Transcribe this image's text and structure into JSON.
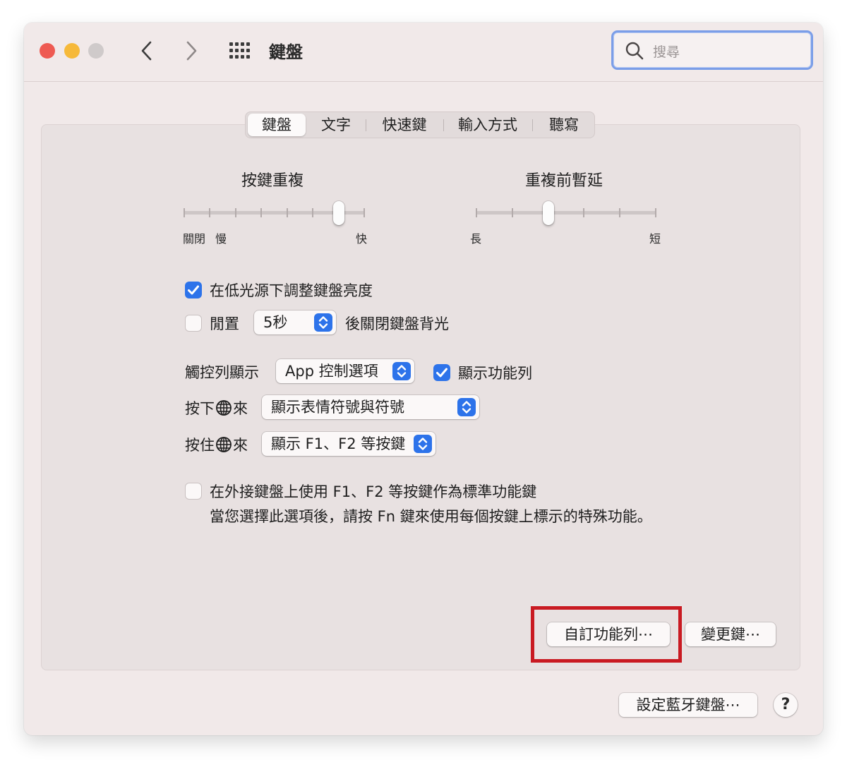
{
  "window": {
    "title": "鍵盤"
  },
  "search": {
    "placeholder": "搜尋"
  },
  "tabs": [
    {
      "label": "鍵盤",
      "active": true
    },
    {
      "label": "文字",
      "active": false
    },
    {
      "label": "快速鍵",
      "active": false
    },
    {
      "label": "輸入方式",
      "active": false
    },
    {
      "label": "聽寫",
      "active": false
    }
  ],
  "key_repeat": {
    "title": "按鍵重複",
    "left_label_off": "關閉",
    "left_label_slow": "慢",
    "right_label": "快",
    "position": 6,
    "steps": 8
  },
  "repeat_delay": {
    "title": "重複前暫延",
    "left_label": "長",
    "right_label": "短",
    "position": 2,
    "steps": 6
  },
  "options": {
    "adjust_brightness": {
      "label": "在低光源下調整鍵盤亮度",
      "checked": true
    },
    "idle_off": {
      "label": "閒置",
      "checked": false,
      "value": "5秒",
      "suffix": "後關閉鍵盤背光"
    },
    "touchbar": {
      "label": "觸控列顯示",
      "value": "App 控制選項"
    },
    "show_control_strip": {
      "label": "顯示功能列",
      "checked": true
    },
    "press_globe": {
      "label_prefix": "按下",
      "label_suffix": "來",
      "value": "顯示表情符號與符號"
    },
    "hold_globe": {
      "label_prefix": "按住",
      "label_suffix": "來",
      "value": "顯示 F1、F2 等按鍵"
    },
    "fn_keys": {
      "label": "在外接鍵盤上使用 F1、F2 等按鍵作為標準功能鍵",
      "checked": false,
      "description": "當您選擇此選項後，請按 Fn 鍵來使用每個按鍵上標示的特殊功能。"
    }
  },
  "buttons": {
    "customize_control_strip": "自訂功能列⋯",
    "modifier_keys": "變更鍵⋯",
    "bluetooth_keyboard": "設定藍牙鍵盤⋯",
    "help": "?"
  },
  "colors": {
    "accent": "#2d73ea",
    "highlight_box": "#c91a22",
    "search_focus": "#7b9ee8"
  }
}
